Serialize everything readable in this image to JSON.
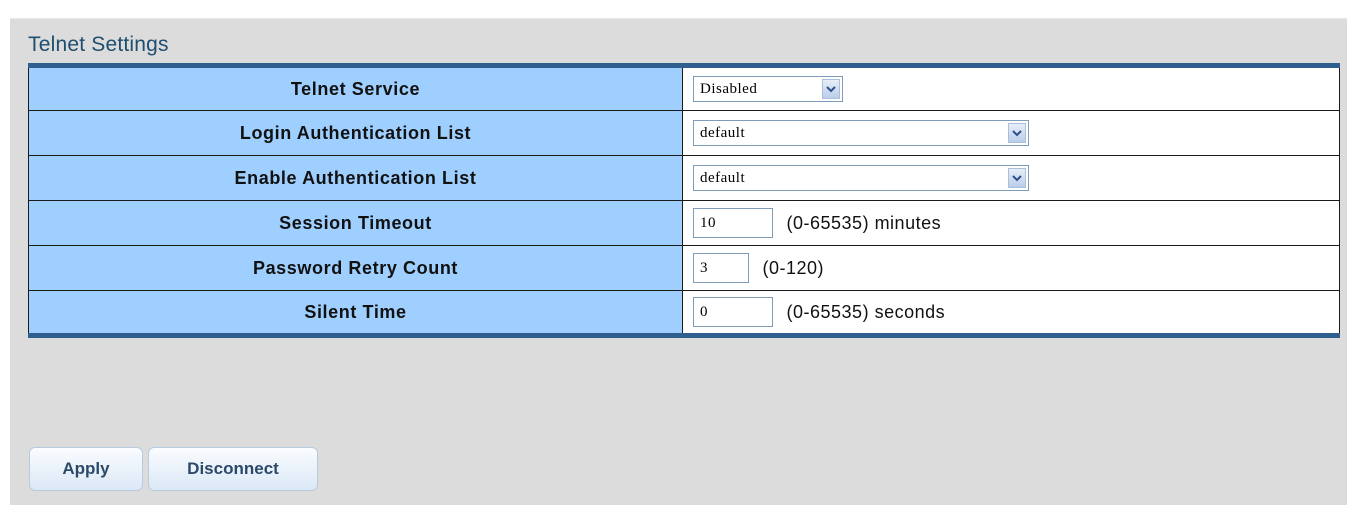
{
  "page": {
    "title": "Telnet Settings"
  },
  "settings": [
    {
      "label": "Telnet Service",
      "type": "select",
      "value": "Disabled"
    },
    {
      "label": "Login Authentication List",
      "type": "select",
      "value": "default"
    },
    {
      "label": "Enable Authentication List",
      "type": "select",
      "value": "default"
    },
    {
      "label": "Session Timeout",
      "type": "input",
      "value": "10",
      "range": "(0-65535) minutes"
    },
    {
      "label": "Password Retry Count",
      "type": "input",
      "value": "3",
      "range": "(0-120)"
    },
    {
      "label": "Silent Time",
      "type": "input",
      "value": "0",
      "range": "(0-65535) seconds"
    }
  ],
  "buttons": {
    "apply": "Apply",
    "disconnect": "Disconnect"
  },
  "colors": {
    "label_background": "#9ECFFF",
    "table_accent": "#2F5F8F",
    "title_color": "#1F4E6E",
    "panel_background": "#DCDCDC"
  },
  "icons": {
    "dropdown": "chevron-down-icon"
  }
}
